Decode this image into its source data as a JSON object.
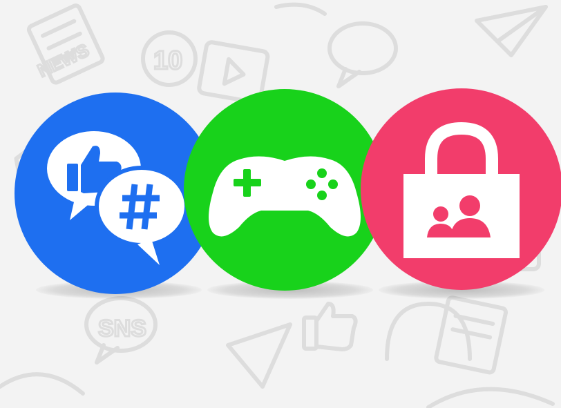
{
  "background": {
    "color": "#f3f3f3",
    "doodle_color": "#dcdcdc",
    "doodle_texts": [
      "NEWS",
      "SNS",
      "10"
    ],
    "doodle_icons": [
      "newspaper-icon",
      "speech-bubble-icon",
      "play-icon",
      "badge-icon",
      "thumbs-up-icon",
      "headphones-icon",
      "megaphone-icon",
      "paper-plane-icon"
    ]
  },
  "icons": [
    {
      "name": "social-media-icon",
      "color": "#1e6ff0",
      "glyphs": [
        "thumbs-up-icon",
        "hashtag-icon",
        "speech-bubble-icon"
      ]
    },
    {
      "name": "game-controller-icon",
      "color": "#18d21b",
      "glyphs": [
        "d-pad-plus-icon",
        "action-buttons-icon"
      ]
    },
    {
      "name": "privacy-lock-icon",
      "color": "#f23d6b",
      "glyphs": [
        "padlock-icon",
        "people-icon"
      ]
    }
  ]
}
